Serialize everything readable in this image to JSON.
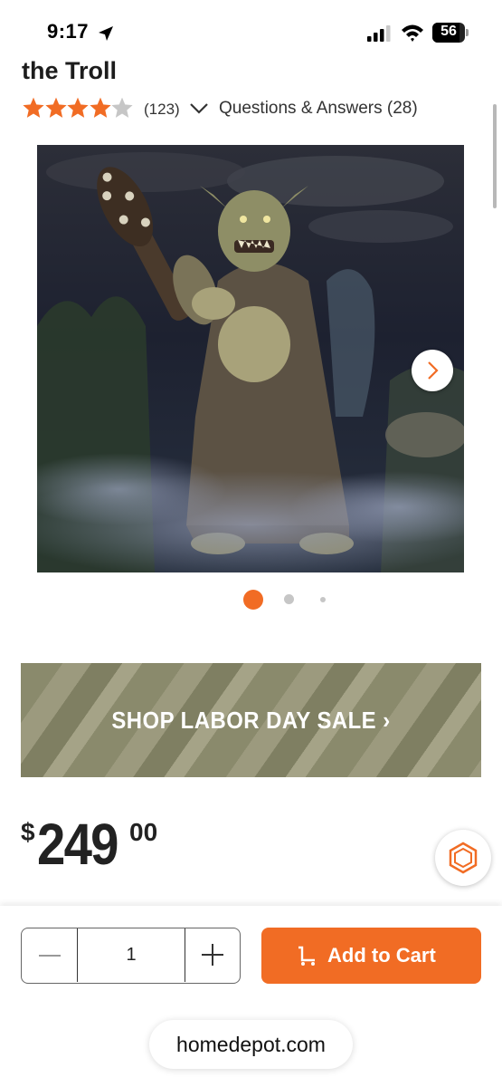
{
  "status_bar": {
    "time": "9:17",
    "battery": "56",
    "icons": [
      "location-arrow-icon",
      "cellular-signal-icon",
      "wifi-icon",
      "battery-icon"
    ]
  },
  "product": {
    "title": "the Troll",
    "rating": 4,
    "rating_max": 5,
    "review_count": "(123)",
    "qa_label": "Questions & Answers (28)",
    "image_count": 3,
    "active_image": 1
  },
  "banner": {
    "label": "SHOP LABOR DAY SALE ›"
  },
  "price": {
    "currency": "$",
    "dollars": "249",
    "cents": "00"
  },
  "cart": {
    "quantity": "1",
    "add_label": "Add to Cart"
  },
  "browser": {
    "url": "homedepot.com"
  },
  "colors": {
    "accent": "#f16c24",
    "star_filled": "#f16c24",
    "star_empty": "#c6c6c6",
    "banner": "#8a8a6c"
  }
}
